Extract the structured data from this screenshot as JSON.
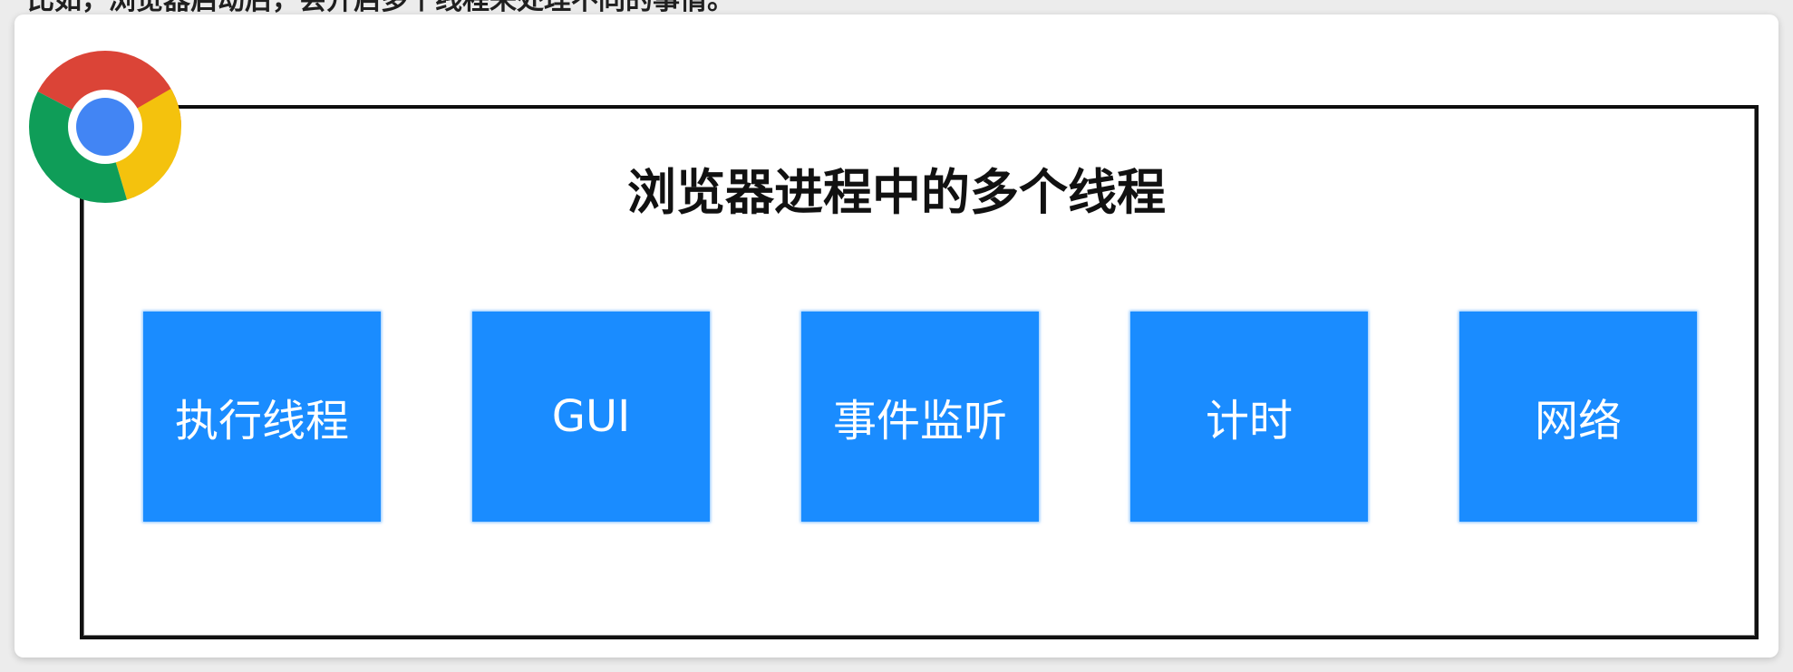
{
  "intro_text": "比如，浏览器启动后，会开启多个线程来处理不同的事情。",
  "diagram": {
    "title": "浏览器进程中的多个线程",
    "threads": [
      {
        "label": "执行线程"
      },
      {
        "label": "GUI"
      },
      {
        "label": "事件监听"
      },
      {
        "label": "计时"
      },
      {
        "label": "网络"
      }
    ]
  },
  "colors": {
    "box_fill": "#1a8cff",
    "frame": "#111111",
    "chrome_red": "#db4437",
    "chrome_yellow": "#f4c20d",
    "chrome_green": "#0f9d58",
    "chrome_blue": "#4285f4"
  },
  "icons": {
    "logo": "chrome-logo-icon"
  }
}
